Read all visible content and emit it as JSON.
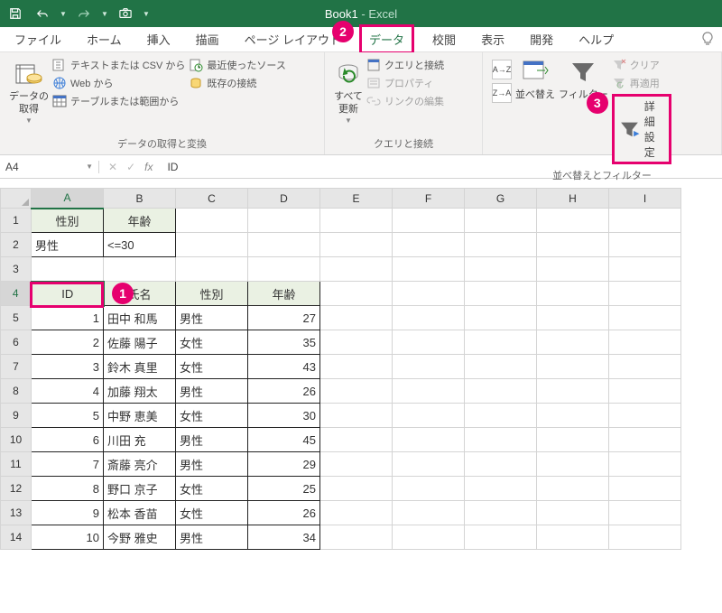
{
  "titlebar": {
    "filename": "Book1",
    "sep": "  -  ",
    "app": "Excel"
  },
  "tabs": {
    "file": "ファイル",
    "home": "ホーム",
    "insert": "挿入",
    "draw": "描画",
    "layout": "ページ レイアウト",
    "data": "データ",
    "review": "校閲",
    "view": "表示",
    "dev": "開発",
    "help": "ヘルプ"
  },
  "ribbon": {
    "getdata": {
      "label": "データの\n取得",
      "csv": "テキストまたは CSV から",
      "web": "Web から",
      "range": "テーブルまたは範囲から",
      "recent": "最近使ったソース",
      "existing": "既存の接続",
      "group": "データの取得と変換"
    },
    "refresh": {
      "label": "すべて\n更新",
      "queries": "クエリと接続",
      "props": "プロパティ",
      "links": "リンクの編集",
      "group": "クエリと接続"
    },
    "sort": {
      "sort": "並べ替え",
      "filter": "フィルター",
      "clear": "クリア",
      "reapply": "再適用",
      "advanced": "詳細設定",
      "group": "並べ替えとフィルター"
    }
  },
  "callouts": {
    "c1": "1",
    "c2": "2",
    "c3": "3"
  },
  "namebox": "A4",
  "formula": "ID",
  "columns": [
    "A",
    "B",
    "C",
    "D",
    "E",
    "F",
    "G",
    "H",
    "I"
  ],
  "criteria": {
    "headers": [
      "性別",
      "年齢"
    ],
    "row": [
      "男性",
      "<=30"
    ]
  },
  "table": {
    "headers": [
      "ID",
      "氏名",
      "性別",
      "年齢"
    ],
    "rows": [
      {
        "id": 1,
        "name": "田中 和馬",
        "sex": "男性",
        "age": 27
      },
      {
        "id": 2,
        "name": "佐藤 陽子",
        "sex": "女性",
        "age": 35
      },
      {
        "id": 3,
        "name": "鈴木 真里",
        "sex": "女性",
        "age": 43
      },
      {
        "id": 4,
        "name": "加藤 翔太",
        "sex": "男性",
        "age": 26
      },
      {
        "id": 5,
        "name": "中野 恵美",
        "sex": "女性",
        "age": 30
      },
      {
        "id": 6,
        "name": "川田 充",
        "sex": "男性",
        "age": 45
      },
      {
        "id": 7,
        "name": "斎藤 亮介",
        "sex": "男性",
        "age": 29
      },
      {
        "id": 8,
        "name": "野口 京子",
        "sex": "女性",
        "age": 25
      },
      {
        "id": 9,
        "name": "松本 香苗",
        "sex": "女性",
        "age": 26
      },
      {
        "id": 10,
        "name": "今野 雅史",
        "sex": "男性",
        "age": 34
      }
    ]
  }
}
